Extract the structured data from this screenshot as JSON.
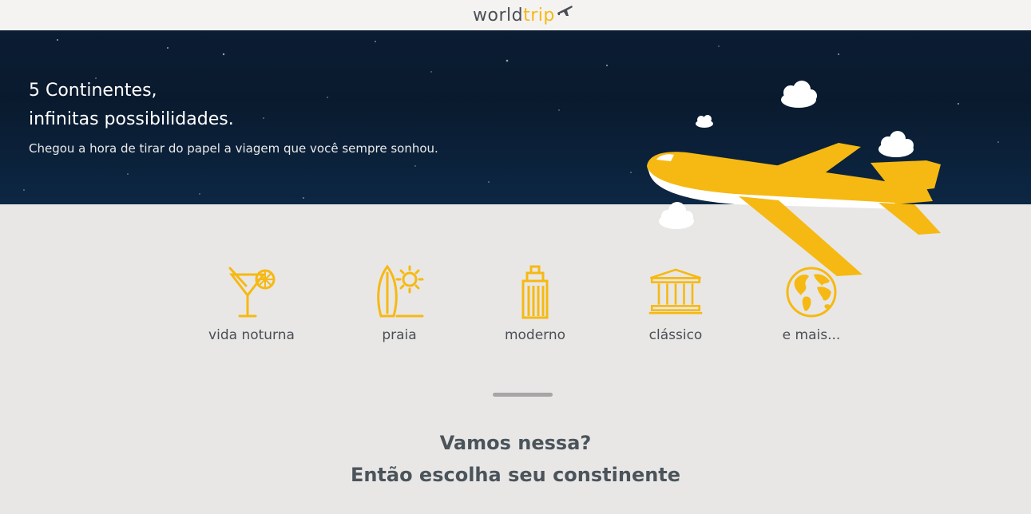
{
  "header": {
    "logo_world": "world",
    "logo_trip": "trip"
  },
  "banner": {
    "title_line1": "5 Continentes,",
    "title_line2": "infinitas possibilidades.",
    "subtitle": "Chegou a hora de tirar do papel a viagem que você sempre sonhou."
  },
  "travel_types": [
    {
      "label": "vida noturna",
      "icon": "cocktail-icon"
    },
    {
      "label": "praia",
      "icon": "surfboard-sun-icon"
    },
    {
      "label": "moderno",
      "icon": "skyscraper-icon"
    },
    {
      "label": "clássico",
      "icon": "classic-building-icon"
    },
    {
      "label": "e mais...",
      "icon": "globe-icon"
    }
  ],
  "cta": {
    "line1": "Vamos nessa?",
    "line2": "Então escolha seu constinente"
  },
  "colors": {
    "accent": "#f6b913",
    "text": "#4b4f55",
    "banner_bg": "#0b1d33",
    "page_bg": "#e8e7e6"
  }
}
